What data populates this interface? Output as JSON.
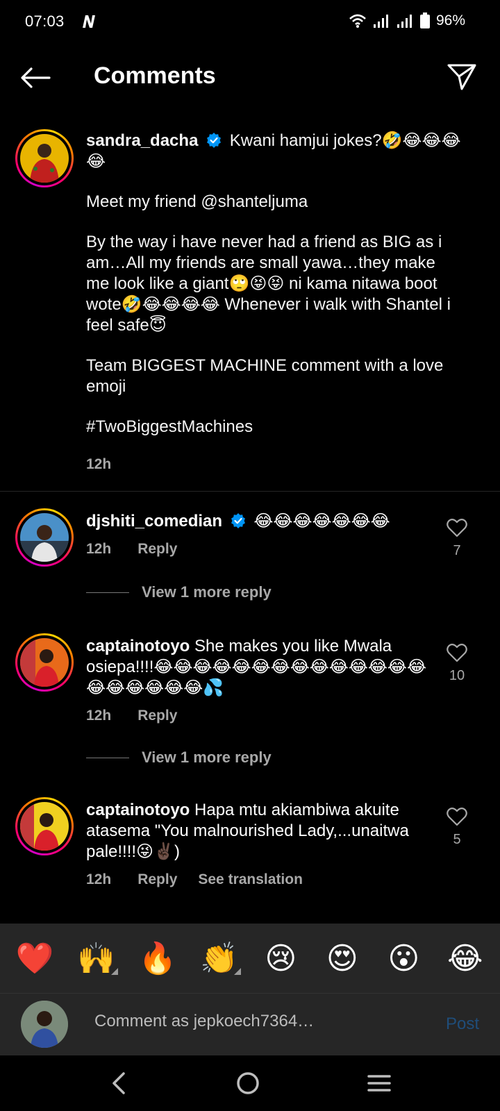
{
  "status_bar": {
    "time": "07:03",
    "battery": "96%"
  },
  "header": {
    "title": "Comments"
  },
  "caption": {
    "username": "sandra_dacha",
    "first_line": "Kwani hamjui jokes?🤣😂😂😂😂",
    "paragraphs": [
      "Meet my friend @shanteljuma",
      "By the way i have never had a friend as BIG as i am…All my friends are small yawa…they make me look like a giant🙄😝😝 ni kama nitawa boot wote🤣😂😂😂😂 Whenever i walk with Shantel i feel safe😇",
      "Team BIGGEST MACHINE comment with a love emoji",
      "#TwoBiggestMachines"
    ],
    "time": "12h"
  },
  "comments": [
    {
      "username": "djshiti_comedian",
      "verified": true,
      "text": "😂😂😂😂😂😂😂",
      "time": "12h",
      "reply_label": "Reply",
      "likes": "7",
      "view_more": "View 1 more reply"
    },
    {
      "username": "captainotoyo",
      "verified": false,
      "text": "She makes you like Mwala osiepa!!!!😂😂😂😂😂😂😂😂😂😂😂😂😂😂😂😂😂😂😂😂💦",
      "time": "12h",
      "reply_label": "Reply",
      "likes": "10",
      "view_more": "View 1 more reply"
    },
    {
      "username": "captainotoyo",
      "verified": false,
      "text": "Hapa mtu akiambiwa akuite atasema \"You malnourished Lady,...unaitwa pale!!!!😜✌🏿)",
      "time": "12h",
      "reply_label": "Reply",
      "translation_label": "See translation",
      "likes": "5"
    }
  ],
  "emoji_bar": [
    "❤️",
    "🙌",
    "🔥",
    "👏",
    "😢",
    "😍",
    "😮",
    "😂"
  ],
  "composer": {
    "placeholder": "Comment as jepkoech7364…",
    "post_label": "Post"
  },
  "colors": {
    "background": "#000000",
    "muted": "#a8a8a8",
    "verified": "#0095f6",
    "post_disabled": "#1f4d7a"
  }
}
